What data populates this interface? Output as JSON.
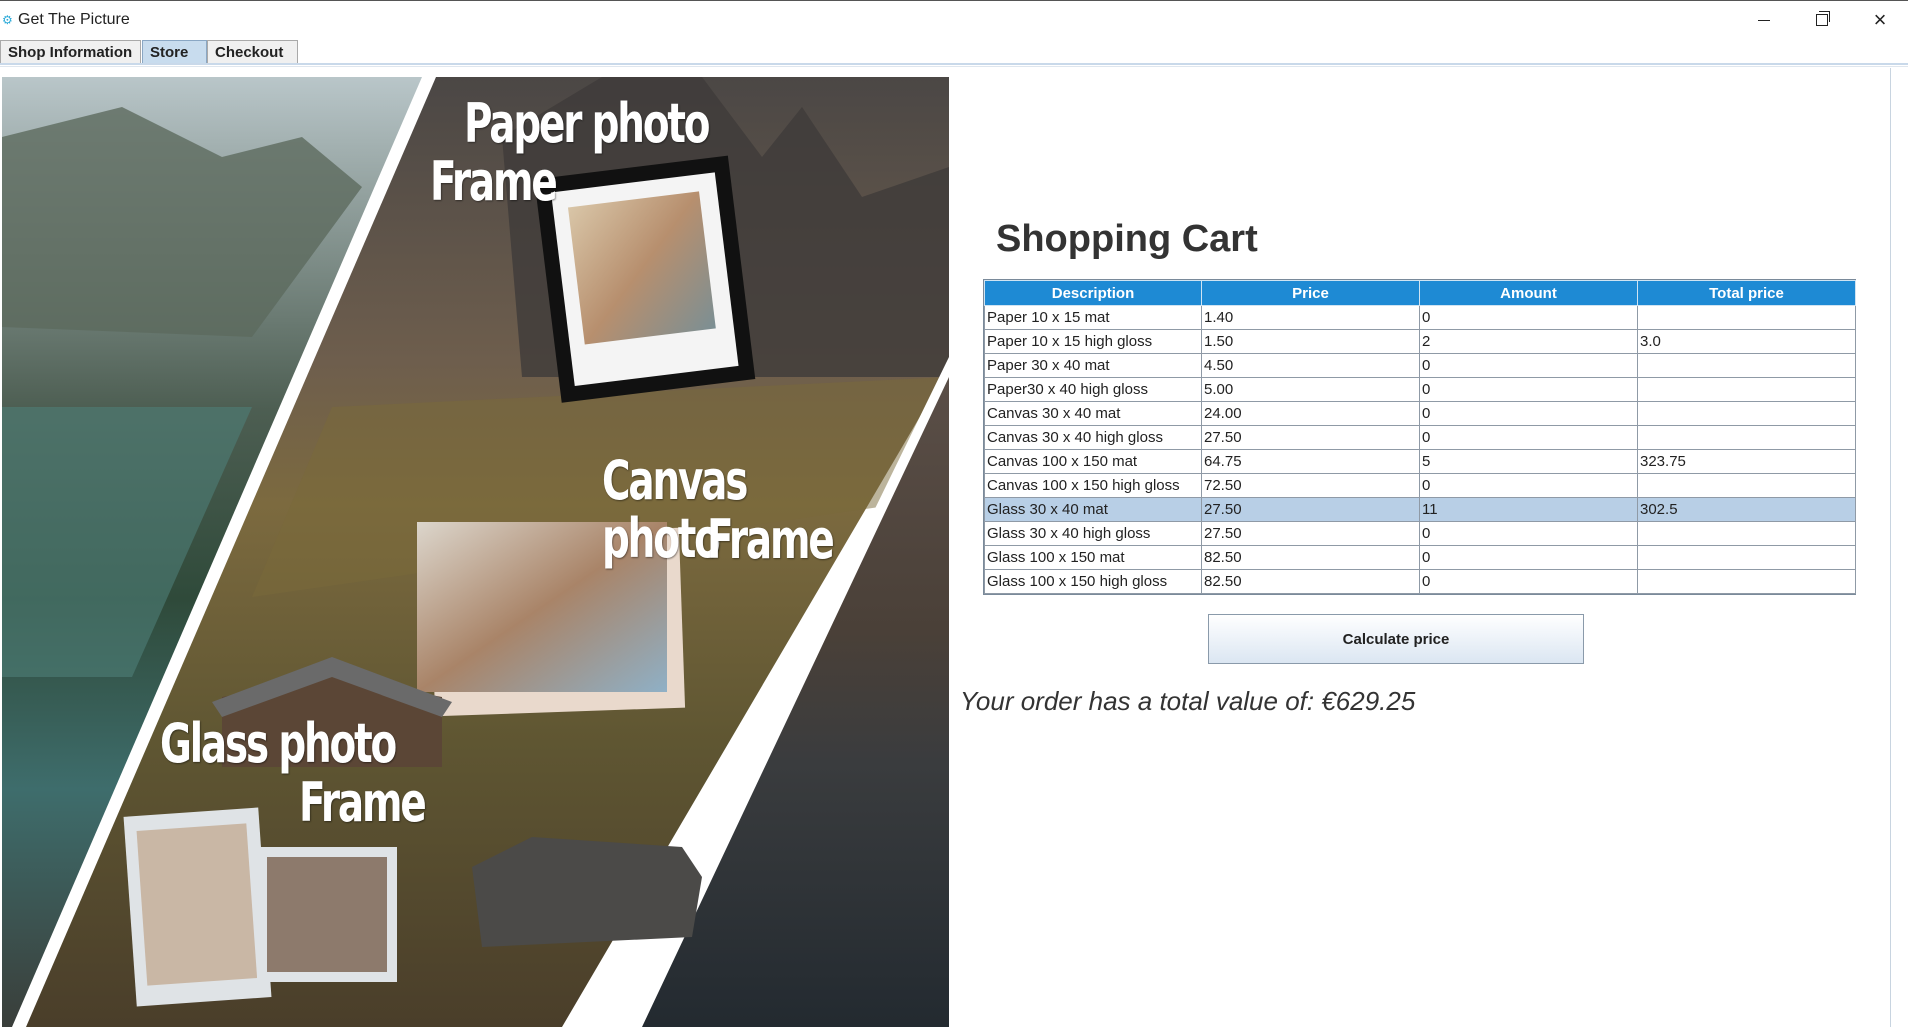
{
  "window": {
    "title": "Get The Picture",
    "app_icon": "gear-icon",
    "controls": {
      "minimize": "minimize-icon",
      "maximize": "restore-icon",
      "close": "×"
    }
  },
  "tabs": [
    {
      "label": "Shop Information",
      "active": false
    },
    {
      "label": "Store",
      "active": true
    },
    {
      "label": "Checkout",
      "active": false
    }
  ],
  "hero": {
    "label_paper_1": "Paper photo",
    "label_paper_2": "Frame",
    "label_canvas_1": "Canvas photo",
    "label_canvas_2": "Frame",
    "label_glass_1": "Glass photo",
    "label_glass_2": "Frame"
  },
  "cart": {
    "title": "Shopping Cart",
    "columns": [
      "Description",
      "Price",
      "Amount",
      "Total price"
    ],
    "rows": [
      [
        "Paper 10 x 15 mat",
        "1.40",
        "0",
        ""
      ],
      [
        "Paper 10 x 15 high gloss",
        "1.50",
        "2",
        "3.0"
      ],
      [
        "Paper 30 x 40 mat",
        "4.50",
        "0",
        ""
      ],
      [
        "Paper30 x 40 high gloss",
        "5.00",
        "0",
        ""
      ],
      [
        "Canvas 30 x 40 mat",
        "24.00",
        "0",
        ""
      ],
      [
        "Canvas 30 x 40 high gloss",
        "27.50",
        "0",
        ""
      ],
      [
        "Canvas 100 x 150 mat",
        "64.75",
        "5",
        "323.75"
      ],
      [
        "Canvas 100 x 150 high gloss",
        "72.50",
        "0",
        ""
      ],
      [
        "Glass 30 x 40 mat",
        "27.50",
        "11",
        "302.5"
      ],
      [
        "Glass 30 x 40 high gloss",
        "27.50",
        "0",
        ""
      ],
      [
        "Glass 100 x 150 mat",
        "82.50",
        "0",
        ""
      ],
      [
        "Glass 100 x 150 high gloss",
        "82.50",
        "0",
        ""
      ]
    ],
    "selected_row": 8,
    "calculate_label": "Calculate price",
    "total_text": "Your order has a total value of: €629.25"
  },
  "colors": {
    "header": "#1e8ad4",
    "selected_row": "#b8cfe6",
    "active_tab": "#c8dcee"
  }
}
